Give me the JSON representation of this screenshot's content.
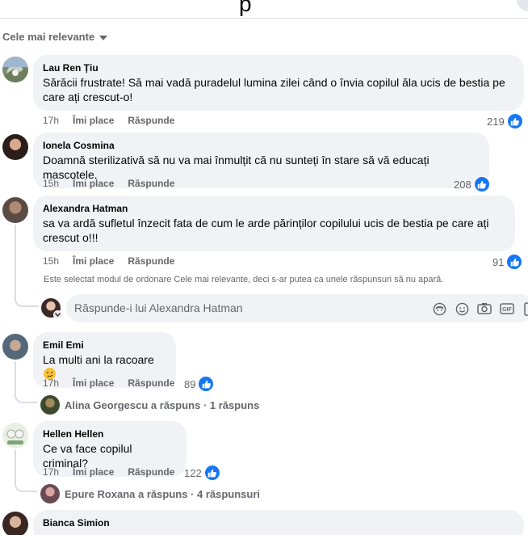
{
  "sort": {
    "label": "Cele mai relevante"
  },
  "comments": [
    {
      "author": "Lau Ren Țiu",
      "text": "Sărăcii frustrate! Să mai vadă puradelul lumina zilei când o învia copilul ăla ucis de bestia pe care ați crescut-o!",
      "time": "17h",
      "like": "Îmi place",
      "reply": "Răspunde",
      "reactions": "219"
    },
    {
      "author": "Ionela Cosmina",
      "text": "Doamnă sterilizativă să nu va mai înmulțit că nu sunteți în stare să vă educați mascotele.",
      "time": "15h",
      "like": "Îmi place",
      "reply": "Răspunde",
      "reactions": "208"
    },
    {
      "author": "Alexandra Hatman",
      "text": "sa va ardă sufletul înzecit fata de cum le arde părinților copilului ucis de bestia pe care ați crescut o!!!",
      "time": "15h",
      "like": "Îmi place",
      "reply": "Răspunde",
      "reactions": "91"
    },
    {
      "author": "Emil Emi",
      "text": "La multi ani la racoare",
      "time": "17h",
      "like": "Îmi place",
      "reply": "Răspunde",
      "reactions": "89",
      "replies_label": "Alina Georgescu a răspuns · 1 răspuns"
    },
    {
      "author": "Hellen Hellen",
      "text": "Ce va face copilul criminal?",
      "time": "17h",
      "like": "Îmi place",
      "reply": "Răspunde",
      "reactions": "122",
      "replies_label": "Epure Roxana a răspuns · 4 răspunsuri"
    },
    {
      "author": "Bianca Simion"
    }
  ],
  "sort_note": "Este selectat modul de ordonare Cele mai relevante, deci s-ar putea ca unele răspunsuri să nu apară.",
  "reply_box": {
    "placeholder": "Răspunde-i lui Alexandra Hatman"
  },
  "colors": {
    "like_blue": "#1877f2",
    "bubble": "#f0f2f5",
    "meta": "#65676b"
  },
  "icons": [
    "chevron-down-icon",
    "like-icon",
    "avatar-sticker-icon",
    "emoji-icon",
    "camera-icon",
    "gif-icon",
    "sticker-icon"
  ]
}
